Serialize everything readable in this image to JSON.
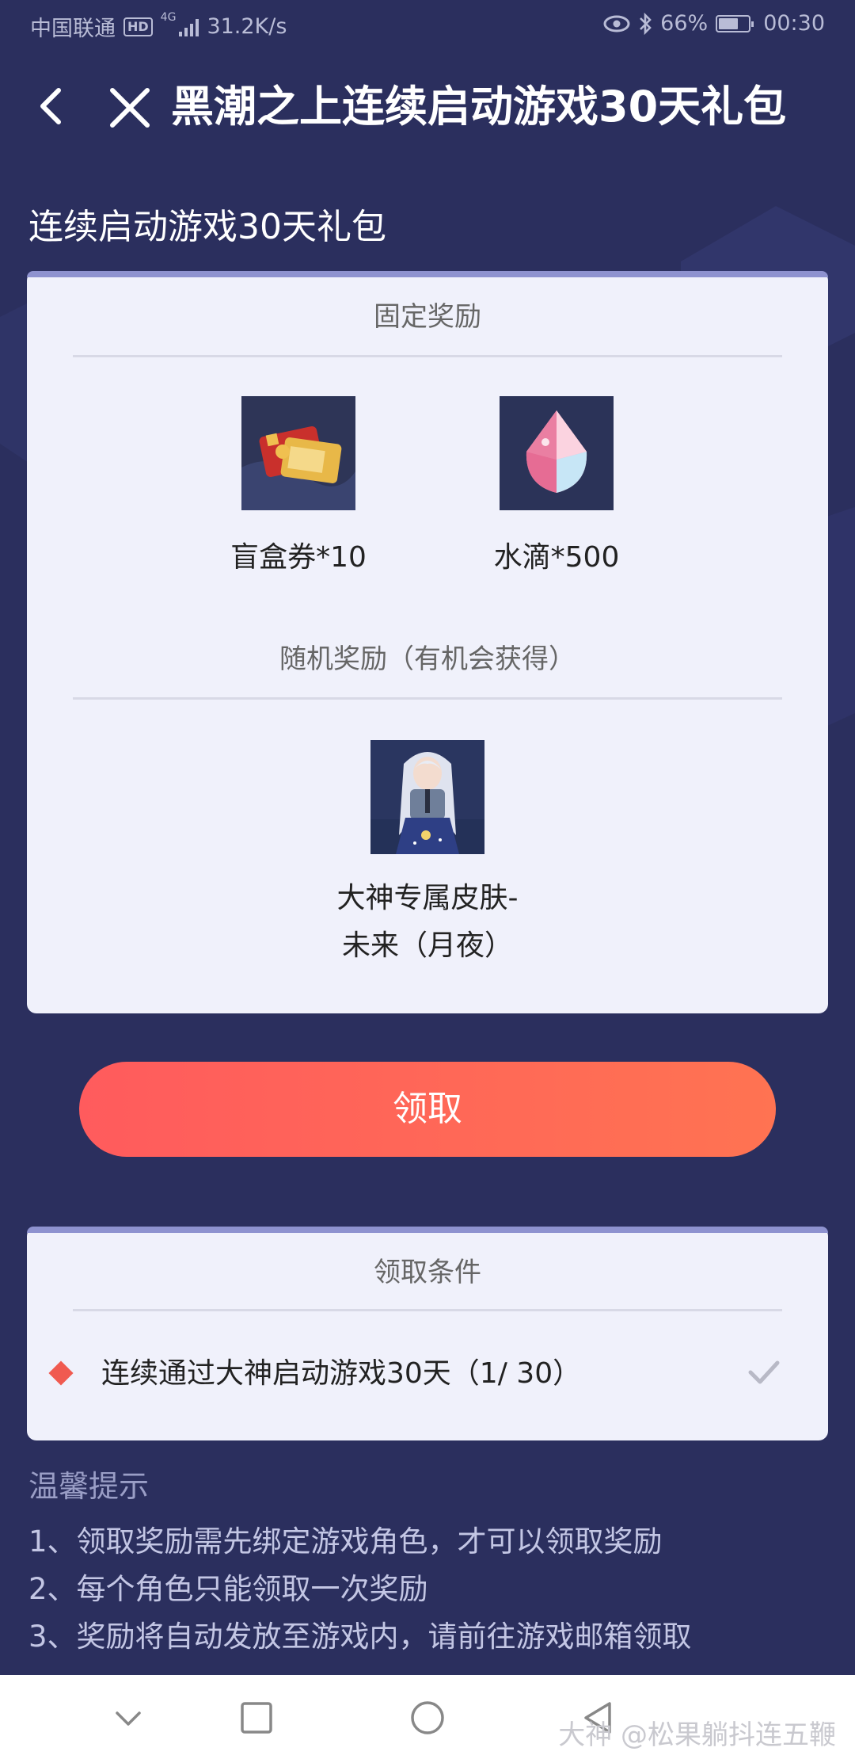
{
  "status_bar": {
    "carrier": "中国联通",
    "hd": "HD",
    "net_type": "4G",
    "speed": "31.2K/s",
    "battery": "66%",
    "battery_level": 0.66,
    "time": "00:30"
  },
  "header": {
    "title": "黑潮之上连续启动游戏30天礼包"
  },
  "subtitle": "连续启动游戏30天礼包",
  "fixed_rewards": {
    "title": "固定奖励",
    "items": [
      {
        "label": "盲盒券*10",
        "icon": "ticket-icon"
      },
      {
        "label": "水滴*500",
        "icon": "crystal-icon"
      }
    ]
  },
  "random_rewards": {
    "title": "随机奖励（有机会获得）",
    "items": [
      {
        "label_line1": "大神专属皮肤-",
        "label_line2": "未来（月夜）",
        "icon": "skin-avatar"
      }
    ]
  },
  "claim_button": "领取",
  "conditions": {
    "title": "领取条件",
    "items": [
      {
        "text": "连续通过大神启动游戏30天（1/ 30）",
        "progress": 1,
        "total": 30
      }
    ]
  },
  "tips": {
    "title": "温馨提示",
    "lines": [
      "1、领取奖励需先绑定游戏角色，才可以领取奖励",
      "2、每个角色只能领取一次奖励",
      "3、奖励将自动发放至游戏内，请前往游戏邮箱领取"
    ]
  },
  "watermark": "大神 @松果躺抖连五鞭",
  "colors": {
    "background": "#2b2f5e",
    "card": "#f0f1fb",
    "button_start": "#ff5b5d",
    "button_end": "#ff7352",
    "diamond": "#f05a50"
  }
}
